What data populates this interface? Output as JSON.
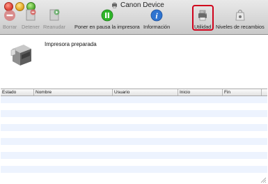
{
  "window": {
    "title": "Canon Device"
  },
  "toolbar": {
    "buttons": [
      {
        "label": "Borrar",
        "icon": "delete-job-icon",
        "enabled": false
      },
      {
        "label": "Detener",
        "icon": "stop-job-icon",
        "enabled": false
      },
      {
        "label": "Reanudar",
        "icon": "resume-job-icon",
        "enabled": false
      },
      {
        "label": "Poner en pausa la impresora",
        "icon": "pause-icon",
        "enabled": true
      },
      {
        "label": "Información",
        "icon": "info-icon",
        "enabled": true
      },
      {
        "label": "Utilidad",
        "icon": "utility-icon",
        "enabled": true,
        "highlighted": true
      },
      {
        "label": "Niveles de recambios",
        "icon": "supply-levels-icon",
        "enabled": true
      }
    ]
  },
  "status": {
    "text": "Impresora preparada"
  },
  "table": {
    "columns": [
      "Estado",
      "Nombre",
      "Usuario",
      "Inicio",
      "Fin"
    ],
    "rows": []
  },
  "colors": {
    "highlight": "#d0021b",
    "row_stripe": "#edf3fe",
    "pause_green": "#2fb52a",
    "info_blue": "#2f74d0"
  }
}
